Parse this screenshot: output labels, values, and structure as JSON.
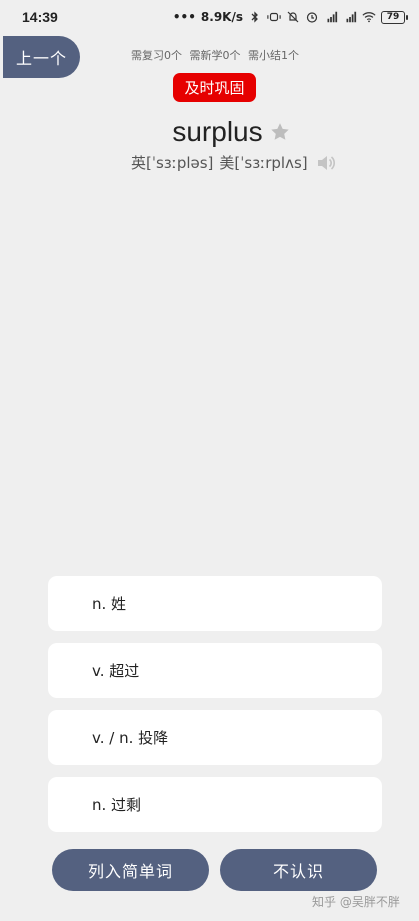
{
  "status_bar": {
    "time": "14:39",
    "network_speed": "8.9K/s",
    "battery": "79"
  },
  "nav": {
    "prev_label": "上一个"
  },
  "counts": {
    "review": "需复习0个",
    "new": "需新学0个",
    "summary": "需小结1个"
  },
  "badge": "及时巩固",
  "word": {
    "text": "surplus",
    "uk_phonetic": "英[ˈsɜːpləs]",
    "us_phonetic": "美[ˈsɜːrplʌs]"
  },
  "options": [
    {
      "label": "n. 姓"
    },
    {
      "label": "v. 超过"
    },
    {
      "label": "v. / n. 投降"
    },
    {
      "label": "n. 过剩"
    }
  ],
  "actions": {
    "add_simple_label": "列入简单词",
    "unknown_label": "不认识"
  },
  "watermark": "知乎 @吴胖不胖",
  "colors": {
    "primary": "#546180",
    "badge": "#e60000",
    "background": "#efefef"
  }
}
